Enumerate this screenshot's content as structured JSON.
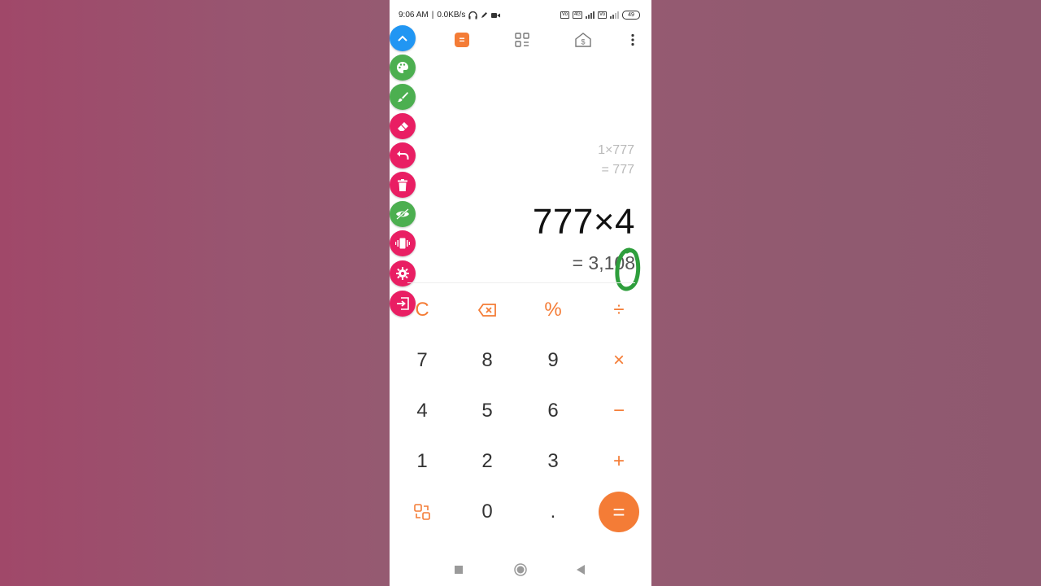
{
  "status": {
    "time": "9:06 AM",
    "speed": "0.0KB/s",
    "battery": "49",
    "net_tag": "4G"
  },
  "toolbar": {
    "icons": [
      "calculator-icon",
      "grid-apps-icon",
      "home-currency-icon",
      "more-vert-icon"
    ],
    "calc_glyph": "="
  },
  "history": {
    "expression": "1×777",
    "result": "= 777"
  },
  "display": {
    "expression": "777×4",
    "result": "= 3,108"
  },
  "keypad": {
    "row1": [
      "C",
      "⌫",
      "%",
      "÷"
    ],
    "row2": [
      "7",
      "8",
      "9",
      "×"
    ],
    "row3": [
      "4",
      "5",
      "6",
      "−"
    ],
    "row4": [
      "1",
      "2",
      "3",
      "+"
    ],
    "row5": [
      "⇄",
      "0",
      ".",
      "="
    ]
  },
  "colors": {
    "accent": "#f47c36",
    "fab_blue": "#2196f3",
    "fab_green": "#4caf50",
    "fab_pink": "#e91e63"
  }
}
